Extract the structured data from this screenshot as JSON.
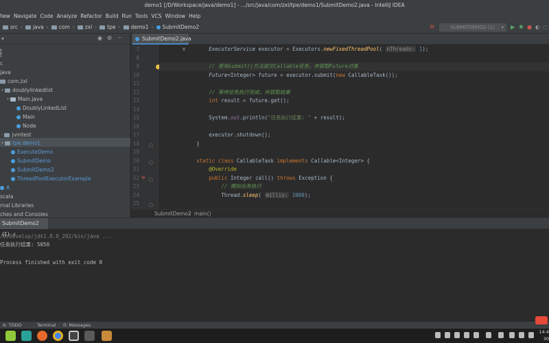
{
  "window": {
    "title": "demo1 [/D/Workspace/java/demo1] - .../src/java/com/zxl/tpe/demo1/SubmitDemo2.java - IntelliJ IDEA"
  },
  "menu": [
    "View",
    "Navigate",
    "Code",
    "Analyze",
    "Refactor",
    "Build",
    "Run",
    "Tools",
    "VCS",
    "Window",
    "Help"
  ],
  "breadcrumbs": [
    "src",
    "java",
    "com",
    "zxl",
    "tpe",
    "demo1",
    "SubmitDemo2"
  ],
  "run_config": "SUBMITDEMO2 (1)",
  "project_tree": [
    {
      "label": "t",
      "top": 0
    },
    {
      "label": "t",
      "top": 0
    },
    {
      "label": "c",
      "top": 0
    },
    {
      "label": "java",
      "top": 0
    },
    {
      "label": "com.zxl",
      "top": 0
    },
    {
      "label": "doublylinkedlist",
      "top": 0
    },
    {
      "label": "Main.java",
      "top": 0
    },
    {
      "label": "DoublyLinkedList",
      "top": 0
    },
    {
      "label": "Main",
      "top": 0
    },
    {
      "label": "Node",
      "top": 0
    },
    {
      "label": "jvmtest",
      "top": 0
    },
    {
      "label": "tpe.demo1",
      "top": 0
    },
    {
      "label": "ExecuteDemo",
      "top": 0
    },
    {
      "label": "SubmitDemo",
      "top": 0
    },
    {
      "label": "SubmitDemo2",
      "top": 0
    },
    {
      "label": "ThreadPoolExecutorExample",
      "top": 0
    },
    {
      "label": "A",
      "top": 0
    },
    {
      "label": "scala",
      "top": 0
    },
    {
      "label": "rnal Libraries",
      "top": 0
    },
    {
      "label": "ches and Consoles",
      "top": 0
    }
  ],
  "editor": {
    "tab": "SubmitDemo2.java",
    "line_numbers": [
      "7",
      "8",
      "9",
      "10",
      "11",
      "12",
      "13",
      "14",
      "15",
      "16",
      "17",
      "18",
      "19",
      "20",
      "21",
      "22",
      "23",
      "24",
      "25"
    ],
    "hints": {
      "nThreads": "nThreads:",
      "millis": "millis:"
    },
    "code": {
      "l7_type": "ExecutorService",
      "l7_var": " executor = Executors.",
      "l7_method": "newFixedThreadPool",
      "l7_val": "1",
      "l9_comment": "// 使用submit()方法提交Callable任务，并获取Future对象",
      "l10_type": "Future",
      "l10_rest": "<Integer> future = executor.submit(",
      "l10_new": "new",
      "l10_end": " CallableTask());",
      "l12_comment": "// 等待任务执行完成，并获取结果",
      "l13_int": "int",
      "l13_rest": " result = future.get();",
      "l15_pre": "System.",
      "l15_out": "out",
      "l15_mid": ".println(",
      "l15_str": "\"任务执行结果: \"",
      "l15_end": " + result);",
      "l17": "executor.shutdown();",
      "l18": "}",
      "l20_static": "static class",
      "l20_name": " CallableTask ",
      "l20_impl": "implements",
      "l20_iface": " Callable",
      "l20_end": "<Integer> {",
      "l21": "@Override",
      "l22_public": "public",
      "l22_mid": " Integer call() ",
      "l22_throws": "throws",
      "l22_end": " Exception {",
      "l23_comment": "// 模拟任务执行",
      "l24_pre": "Thread.",
      "l24_sleep": "sleep",
      "l24_val": "1000",
      "l24_end": ");"
    },
    "crumbs": [
      "SubmitDemo2",
      "main()"
    ]
  },
  "run": {
    "tab": "SubmitDemo2 (1)",
    "lines": [
      "/D/Develop/jdk1.8.0_202/bin/java ...",
      "任务执行结果: 5050",
      "",
      "Process finished with exit code 0"
    ]
  },
  "bottom": {
    "todo": "6: TODO",
    "terminal": "Terminal",
    "messages": "0: Messages"
  },
  "clock": {
    "time": "14:4",
    "date": "30 Ma"
  },
  "colors": {
    "accent": "#4a88c7",
    "keyword": "#cc7832",
    "string": "#6a8759"
  }
}
